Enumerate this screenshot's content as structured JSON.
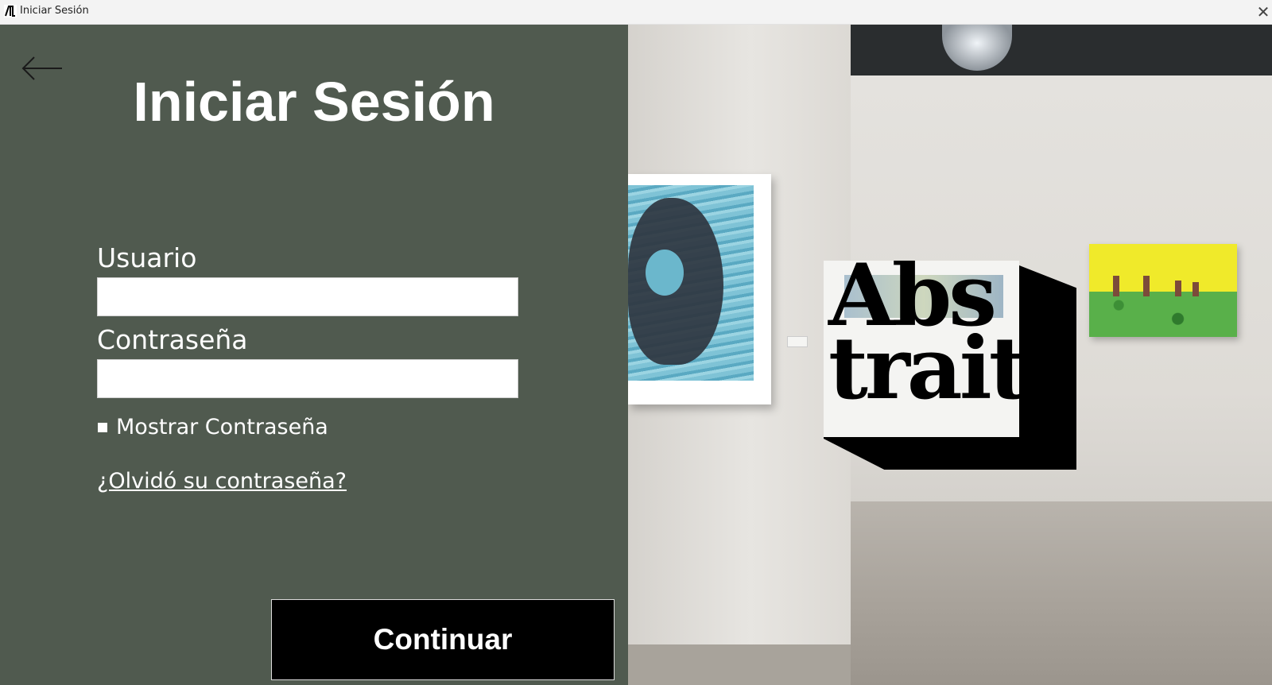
{
  "window": {
    "title": "Iniciar Sesión",
    "close_icon": "close-icon",
    "app_icon": "app-logo-icon"
  },
  "login": {
    "back_icon": "arrow-left-icon",
    "heading": "Iniciar Sesión",
    "username_label": "Usuario",
    "username_value": "",
    "password_label": "Contraseña",
    "password_value": "",
    "show_password_label": "Mostrar Contraseña",
    "show_password_checked": false,
    "forgot_password_link": "¿Olvidó su contraseña?",
    "continue_button": "Continuar"
  },
  "hero": {
    "logo_line1": "Abs",
    "logo_line2": "trait"
  },
  "colors": {
    "panel": "#505a4f",
    "button": "#000000",
    "text": "#ffffff"
  }
}
